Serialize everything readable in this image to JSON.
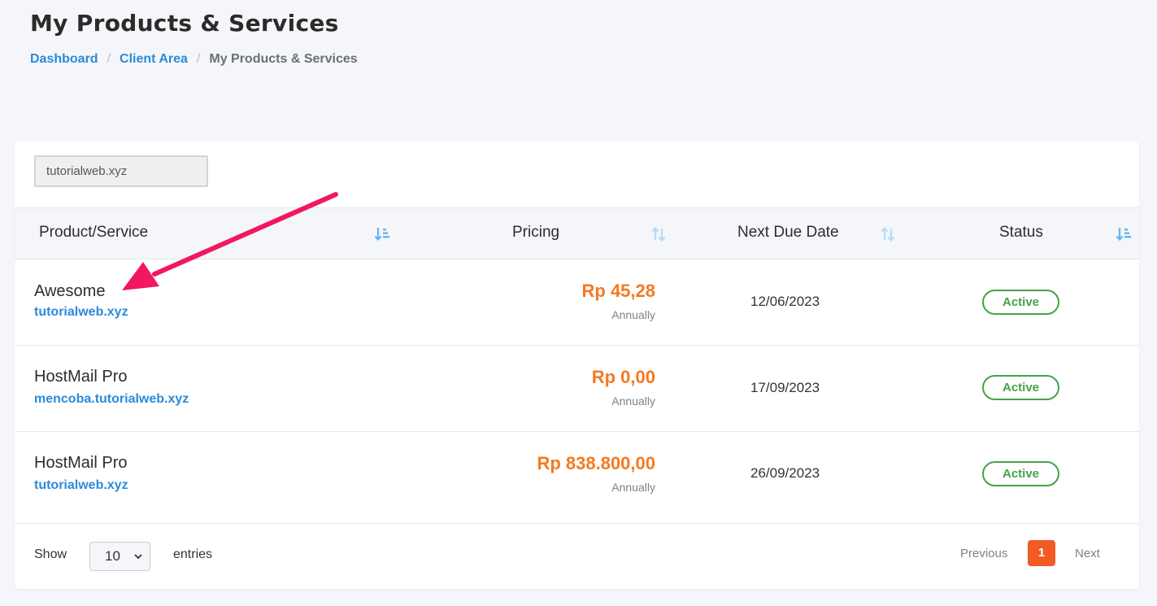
{
  "header": {
    "title": "My Products & Services",
    "breadcrumb": [
      "Dashboard",
      "Client Area",
      "My Products & Services"
    ],
    "breadcrumb_separator": "/"
  },
  "filter": {
    "value": "tutorialweb.xyz"
  },
  "table": {
    "columns": [
      "Product/Service",
      "Pricing",
      "Next Due Date",
      "Status"
    ],
    "rows": [
      {
        "product": "Awesome",
        "domain": "tutorialweb.xyz",
        "price": "Rp 45,28",
        "cycle": "Annually",
        "due": "12/06/2023",
        "status": "Active"
      },
      {
        "product": "HostMail Pro",
        "domain": "mencoba.tutorialweb.xyz",
        "price": "Rp 0,00",
        "cycle": "Annually",
        "due": "17/09/2023",
        "status": "Active"
      },
      {
        "product": "HostMail Pro",
        "domain": "tutorialweb.xyz",
        "price": "Rp 838.800,00",
        "cycle": "Annually",
        "due": "26/09/2023",
        "status": "Active"
      }
    ]
  },
  "footer": {
    "show_label": "Show",
    "page_size": "10",
    "entries_label": "entries",
    "previous_label": "Previous",
    "current_page": "1",
    "next_label": "Next"
  },
  "colors": {
    "link": "#2b8ad9",
    "price": "#f47920",
    "status_active": "#45a248",
    "pagination_active": "#f15a24",
    "annotation_arrow": "#f2185f"
  },
  "icons": {
    "sort_product": "sort-amount-down-icon",
    "sort_pricing": "sort-both-icon",
    "sort_due": "sort-both-icon",
    "sort_status": "sort-amount-down-icon",
    "page_size_chevron": "chevron-down-icon"
  }
}
